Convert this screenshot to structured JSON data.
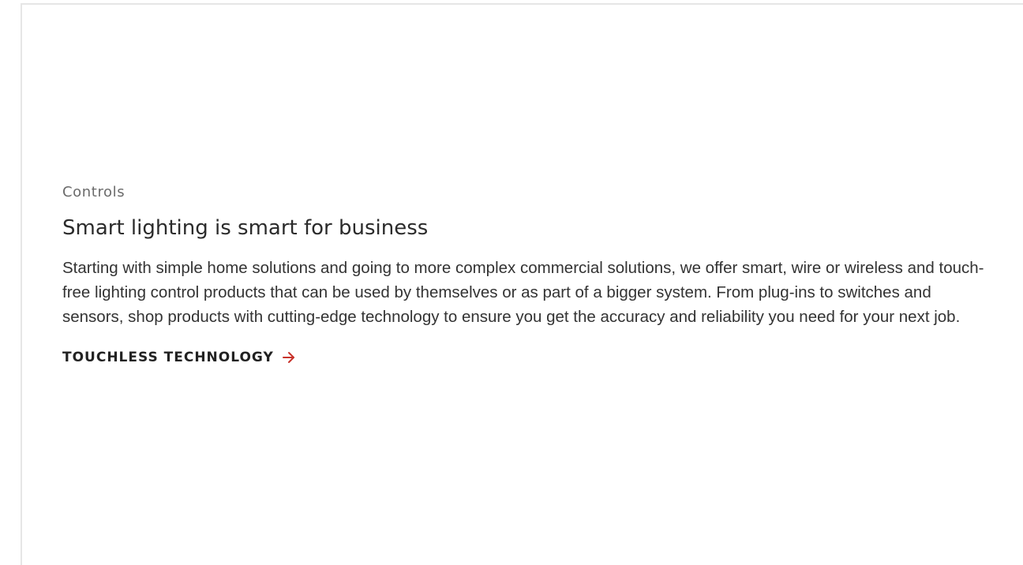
{
  "section": {
    "eyebrow": "Controls",
    "headline": "Smart lighting is smart for business",
    "body": "Starting with simple home solutions and going to more complex commercial solutions, we offer smart, wire or wireless and touch-free lighting control products that can be used by themselves or as part of a bigger system. From plug-ins to switches and sensors, shop products with cutting-edge technology to ensure you get the accuracy and reliability you need for your next job.",
    "cta_label": "TOUCHLESS TECHNOLOGY",
    "cta_icon": "arrow-right-icon"
  },
  "colors": {
    "accent": "#c8332b",
    "text": "#333333",
    "muted": "#6b6b6b",
    "border": "#e6e6e6"
  }
}
